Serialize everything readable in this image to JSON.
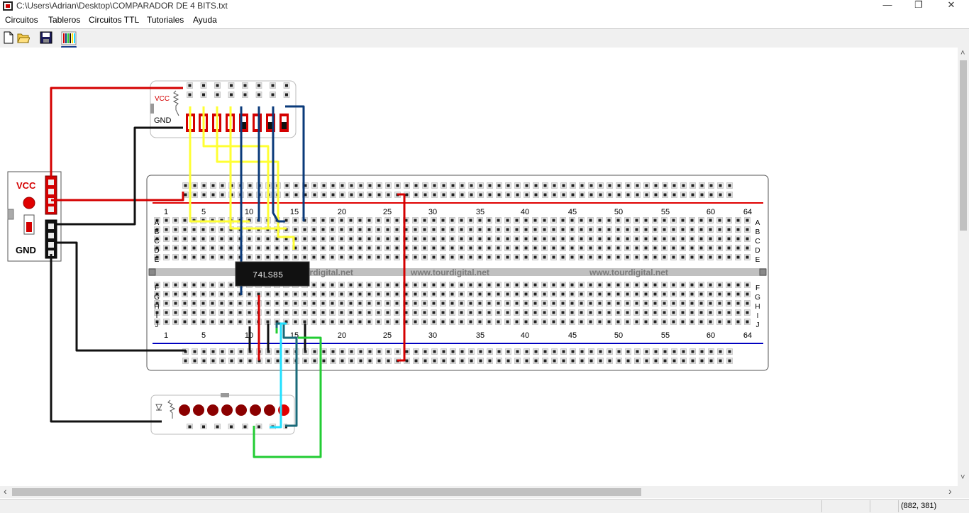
{
  "window": {
    "title": "C:\\Users\\Adrian\\Desktop\\COMPARADOR DE 4 BITS.txt",
    "minimize_glyph": "—",
    "maximize_glyph": "❐",
    "close_glyph": "✕"
  },
  "menu": [
    "Circuitos",
    "Tableros",
    "Circuitos TTL",
    "Tutoriales",
    "Ayuda"
  ],
  "toolbar": {
    "icons": [
      "new-file-icon",
      "open-folder-icon",
      "save-icon",
      "wires-icon"
    ]
  },
  "power_supply": {
    "vcc_label": "VCC",
    "gnd_label": "GND"
  },
  "switch_board": {
    "vcc_label": "VCC",
    "gnd_label": "GND"
  },
  "breadboard": {
    "column_numbers": [
      "1",
      "5",
      "10",
      "15",
      "20",
      "25",
      "30",
      "35",
      "40",
      "45",
      "50",
      "55",
      "60",
      "64"
    ],
    "top_rows": [
      "A",
      "B",
      "C",
      "D",
      "E"
    ],
    "bottom_rows": [
      "F",
      "G",
      "H",
      "I",
      "J"
    ],
    "watermarks": [
      "www.tourdigital.net",
      "www.tourdigital.net",
      "www.tourdigital.net"
    ]
  },
  "chip": {
    "label": "74LS85"
  },
  "scrollbars": {
    "left_arrow": "‹",
    "right_arrow": "›",
    "up_arrow": "˄",
    "down_arrow": "˅"
  },
  "status": {
    "coords": "(882, 381)"
  },
  "colors": {
    "red_wire": "#d40000",
    "black_wire": "#111111",
    "yellow_wire": "#ffff33",
    "blue_wire": "#0a3a7a",
    "cyan_wire": "#22e0ff",
    "green_wire": "#22cc33",
    "teal_wire": "#1a6a7a",
    "rail_red": "#e00000",
    "rail_blue": "#0000c0",
    "chip": "#111111"
  }
}
